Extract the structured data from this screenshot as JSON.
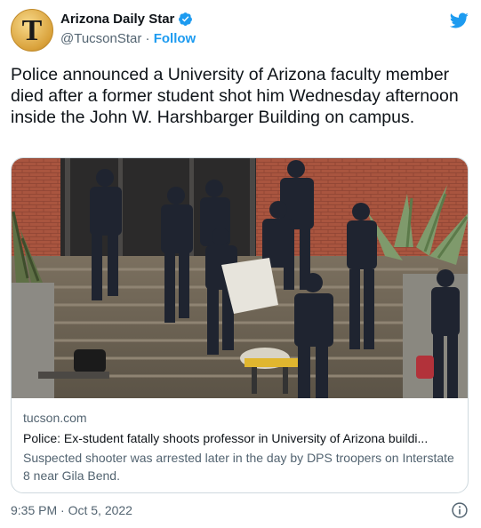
{
  "author": {
    "avatar_letter": "T",
    "name": "Arizona Daily Star",
    "handle": "@TucsonStar",
    "separator": "·",
    "follow_label": "Follow",
    "verified_color": "#1d9bf0"
  },
  "tweet": {
    "text": "Police announced a University of Arizona faculty member died after a former student shot him Wednesday afternoon inside the John W. Harshbarger Building on campus."
  },
  "card": {
    "domain": "tucson.com",
    "headline": "Police: Ex-student fatally shoots professor in University of Arizona buildi...",
    "description": "Suspected shooter was arrested later in the day by DPS troopers on Interstate 8 near Gila Bend."
  },
  "meta": {
    "timestamp": "9:35 PM · Oct 5, 2022"
  },
  "icons": {
    "platform": "bird-icon",
    "verified": "verified-badge-icon",
    "info": "info-icon"
  },
  "colors": {
    "accent": "#1d9bf0",
    "text": "#0f1419",
    "secondary": "#536471",
    "border": "#cfd9de"
  }
}
